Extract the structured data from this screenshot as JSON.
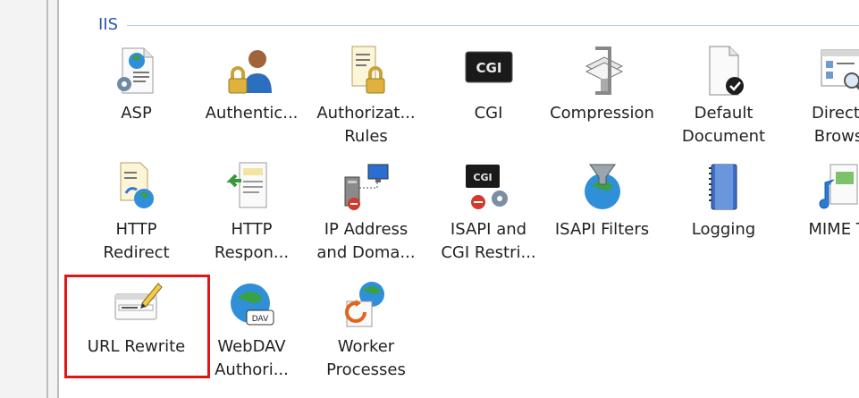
{
  "group": {
    "title": "IIS"
  },
  "highlight_color": "#e01515",
  "features": [
    {
      "label": "ASP",
      "icon": "asp-icon"
    },
    {
      "label": "Authentic...",
      "icon": "authentication-icon"
    },
    {
      "label": "Authorizat...\nRules",
      "icon": "authorization-rules-icon"
    },
    {
      "label": "CGI",
      "icon": "cgi-icon"
    },
    {
      "label": "Compression",
      "icon": "compression-icon"
    },
    {
      "label": "Default\nDocument",
      "icon": "default-document-icon"
    },
    {
      "label": "Directo\nBrowsi",
      "icon": "directory-browsing-icon"
    },
    {
      "label": "HTTP\nRedirect",
      "icon": "http-redirect-icon"
    },
    {
      "label": "HTTP\nRespon...",
      "icon": "http-response-headers-icon"
    },
    {
      "label": "IP Address\nand Doma...",
      "icon": "ip-address-domain-icon"
    },
    {
      "label": "ISAPI and\nCGI Restri...",
      "icon": "isapi-cgi-restrictions-icon"
    },
    {
      "label": "ISAPI Filters",
      "icon": "isapi-filters-icon"
    },
    {
      "label": "Logging",
      "icon": "logging-icon"
    },
    {
      "label": "MIME Ty",
      "icon": "mime-types-icon"
    },
    {
      "label": "URL Rewrite",
      "icon": "url-rewrite-icon"
    },
    {
      "label": "WebDAV\nAuthori...",
      "icon": "webdav-authoring-icon"
    },
    {
      "label": "Worker\nProcesses",
      "icon": "worker-processes-icon"
    }
  ]
}
